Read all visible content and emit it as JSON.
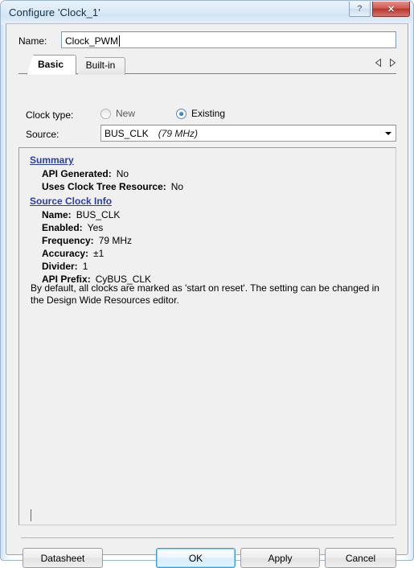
{
  "window": {
    "title": "Configure 'Clock_1'",
    "buttons": {
      "help": "?",
      "close": "✕"
    }
  },
  "form": {
    "name_label": "Name:",
    "name_value": "Clock_PWM",
    "name_placeholder": "",
    "clock_type_label": "Clock type:",
    "clock_type_options": [
      "New",
      "Existing"
    ],
    "clock_type_selected": "Existing",
    "source_label": "Source:",
    "source_value": "BUS_CLK",
    "source_freq": "(79 MHz)"
  },
  "tabs": {
    "items": [
      {
        "label": "Basic",
        "selected": true
      },
      {
        "label": "Built-in",
        "selected": false
      }
    ],
    "nav_prev": "prev-tab-arrow",
    "nav_next": "next-tab-arrow"
  },
  "info": {
    "summary_heading": "Summary",
    "summary_rows": [
      {
        "key": "API Generated:",
        "value": "No"
      },
      {
        "key": "Uses Clock Tree Resource:",
        "value": "No"
      }
    ],
    "source_heading": "Source Clock Info",
    "source_rows": [
      {
        "key": "Name:",
        "value": "BUS_CLK"
      },
      {
        "key": "Enabled:",
        "value": "Yes"
      },
      {
        "key": "Frequency:",
        "value": "79 MHz"
      },
      {
        "key": "Accuracy:",
        "value": "±1"
      },
      {
        "key": "Divider:",
        "value": "1"
      },
      {
        "key": "API Prefix:",
        "value": "CyBUS_CLK"
      }
    ],
    "note": "By default, all clocks are marked as 'start on reset'. The setting can be changed in the Design Wide Resources editor."
  },
  "footer": {
    "datasheet": "Datasheet",
    "ok": "OK",
    "apply": "Apply",
    "cancel": "Cancel"
  },
  "colors": {
    "accent": "#3f95d2",
    "heading_link": "#2b3fa0",
    "close_button": "#b8352c",
    "radio_selected": "#1d6fb4"
  }
}
